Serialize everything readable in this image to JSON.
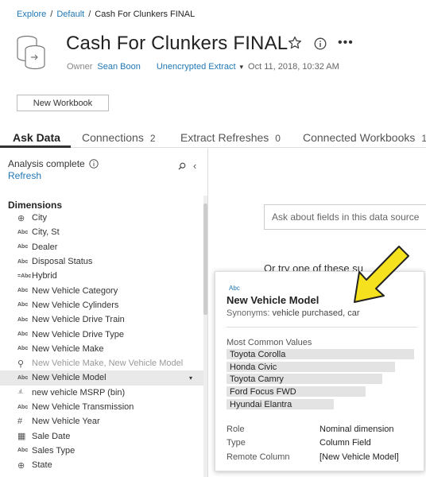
{
  "breadcrumb": {
    "items": [
      "Explore",
      "Default"
    ],
    "separator": "/",
    "current": "Cash For Clunkers FINAL"
  },
  "header": {
    "title": "Cash For Clunkers FINAL",
    "owner_label": "Owner",
    "owner_name": "Sean Boon",
    "extract_label": "Unencrypted Extract",
    "caret": "▾",
    "date": "Oct 11, 2018, 10:32 AM",
    "more": "•••"
  },
  "actions": {
    "new_workbook": "New Workbook"
  },
  "tabs": [
    {
      "label": "Ask Data",
      "count": ""
    },
    {
      "label": "Connections",
      "count": "2"
    },
    {
      "label": "Extract Refreshes",
      "count": "0"
    },
    {
      "label": "Connected Workbooks",
      "count": "1"
    }
  ],
  "sidebar": {
    "status": "Analysis complete",
    "refresh": "Refresh",
    "collapse": "‹",
    "dimensions_heading": "Dimensions",
    "items": [
      {
        "icon": "globe-icon",
        "glyph": "⊕",
        "label": "City"
      },
      {
        "icon": "abc-icon",
        "glyph": "Abc",
        "label": "City, St"
      },
      {
        "icon": "abc-icon",
        "glyph": "Abc",
        "label": "Dealer"
      },
      {
        "icon": "abc-icon",
        "glyph": "Abc",
        "label": "Disposal Status"
      },
      {
        "icon": "abc-icon",
        "glyph": "=Abc",
        "label": "Hybrid"
      },
      {
        "icon": "abc-icon",
        "glyph": "Abc",
        "label": "New Vehicle Category"
      },
      {
        "icon": "abc-icon",
        "glyph": "Abc",
        "label": "New Vehicle Cylinders"
      },
      {
        "icon": "abc-icon",
        "glyph": "Abc",
        "label": "New Vehicle Drive Train"
      },
      {
        "icon": "abc-icon",
        "glyph": "Abc",
        "label": "New Vehicle Drive Type"
      },
      {
        "icon": "abc-icon",
        "glyph": "Abc",
        "label": "New Vehicle Make"
      },
      {
        "icon": "hierarchy-icon",
        "glyph": "⚲",
        "label": "New Vehicle Make, New Vehicle Model"
      },
      {
        "icon": "abc-icon",
        "glyph": "Abc",
        "label": "New Vehicle Model"
      },
      {
        "icon": "bin-icon",
        "glyph": ".ıl.",
        "label": "new vehicle MSRP (bin)"
      },
      {
        "icon": "abc-icon",
        "glyph": "Abc",
        "label": "New Vehicle Transmission"
      },
      {
        "icon": "number-icon",
        "glyph": "#",
        "label": "New Vehicle Year"
      },
      {
        "icon": "calendar-icon",
        "glyph": "▦",
        "label": "Sale Date"
      },
      {
        "icon": "abc-icon",
        "glyph": "Abc",
        "label": "Sales Type"
      },
      {
        "icon": "globe-icon",
        "glyph": "⊕",
        "label": "State"
      }
    ],
    "selected_item": "New Vehicle Model",
    "row_caret": "▾"
  },
  "ask": {
    "placeholder": "Ask about fields in this data source",
    "try_text": "Or try one of these su"
  },
  "tooltip": {
    "type_label": "Abc",
    "field_name": "New Vehicle Model",
    "synonyms_label": "Synonyms:",
    "synonyms": "vehicle purchased, car",
    "most_common_label": "Most Common Values",
    "values": [
      {
        "label": "Toyota Corolla",
        "share": 1.0
      },
      {
        "label": "Honda Civic",
        "share": 0.9
      },
      {
        "label": "Toyota Camry",
        "share": 0.83
      },
      {
        "label": "Ford Focus FWD",
        "share": 0.74
      },
      {
        "label": "Hyundai Elantra",
        "share": 0.57
      }
    ],
    "properties": [
      {
        "key": "Role",
        "value": "Nominal dimension"
      },
      {
        "key": "Type",
        "value": "Column Field"
      },
      {
        "key": "Remote Column",
        "value": "[New Vehicle Model]"
      }
    ]
  },
  "colors": {
    "link": "#1f77b4",
    "highlight_arrow": "#f5e11d",
    "arrow_outline": "#222222"
  }
}
